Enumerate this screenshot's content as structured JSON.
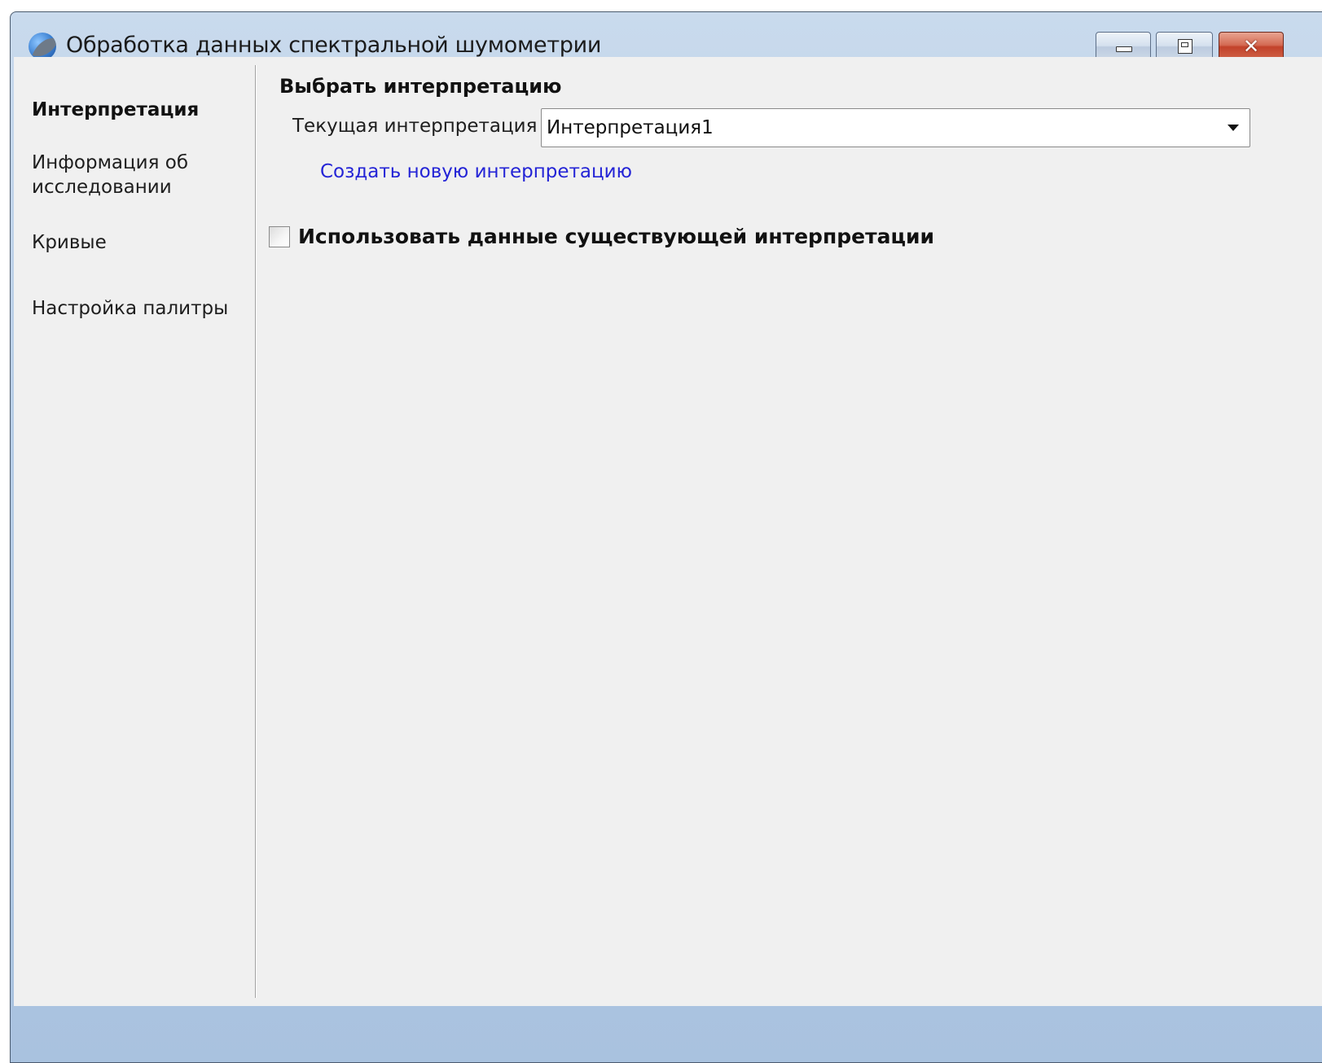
{
  "window": {
    "title": "Обработка данных спектральной шумометрии",
    "icon": "app-logo-icon",
    "controls": {
      "minimize": "minimize-icon",
      "maximize": "maximize-icon",
      "close_glyph": "✕"
    }
  },
  "sidebar": {
    "items": [
      {
        "label": "Интерпретация",
        "active": true
      },
      {
        "label": "Информация об исследовании",
        "active": false
      },
      {
        "label": "Кривые",
        "active": false
      },
      {
        "label": "Настройка палитры",
        "active": false
      }
    ]
  },
  "main": {
    "section_title": "Выбрать интерпретацию",
    "current_label": "Текущая интерпретация",
    "current_value": "Интерпретация1",
    "create_link": "Создать новую интерпретацию",
    "use_existing_label": "Использовать данные существующей интерпретации",
    "use_existing_checked": false
  },
  "colors": {
    "link": "#2424d6",
    "titlebar": "#b7cde6",
    "client_bg": "#f0f0f0",
    "close_button": "#c2422a"
  }
}
